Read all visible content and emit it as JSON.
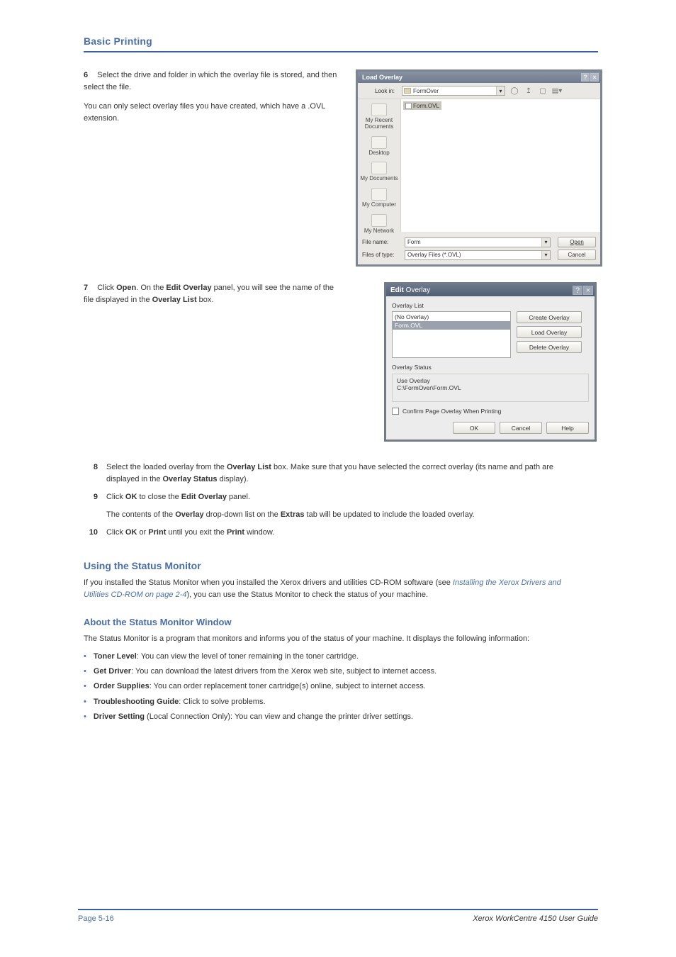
{
  "page_title": "Basic Printing",
  "steps": {
    "s6": {
      "num": "6",
      "text_a": "Select the drive and folder in which the overlay file is stored, and then select the file.",
      "text_b": "You can only select overlay files you have created, which have a .OVL extension."
    },
    "s7": {
      "num": "7",
      "text_a": "Click ",
      "btn": "Open",
      "text_b": ". On the ",
      "panel": "Edit Overlay",
      "text_c": " panel, you will see the name of the file displayed in the ",
      "list": "Overlay List",
      "text_d": " box."
    },
    "s8": {
      "num": "8",
      "text_a": "Select the loaded overlay from the ",
      "list": "Overlay List",
      "text_b": " box. Make sure that you have selected the correct overlay (its name and path are displayed in the ",
      "status": "Overlay Status",
      "text_c": " display)."
    },
    "s9": {
      "num": "9",
      "text_a": "Click ",
      "btn": "OK",
      "text_b": " to close the ",
      "panel": "Edit Overlay",
      "text_c": " panel.",
      "para_a": "The contents of the ",
      "label1": "Overlay",
      "para_b": " drop-down list on the ",
      "tab": "Extras",
      "para_c": " tab will be updated to include the loaded overlay."
    },
    "s10": {
      "num": "10",
      "text_a": "Click ",
      "btn1": "OK",
      "text_b": " or ",
      "btn2": "Print",
      "text_c": " until you exit the ",
      "dlg": "Print",
      "text_d": " window."
    }
  },
  "load_dialog": {
    "title": "Load Overlay",
    "lookin_label": "Look in:",
    "lookin_value": "FormOver",
    "places": [
      "My Recent Documents",
      "Desktop",
      "My Documents",
      "My Computer",
      "My Network"
    ],
    "file_item": "Form.OVL",
    "filename_label": "File name:",
    "filename_value": "Form",
    "filetype_label": "Files of type:",
    "filetype_value": "Overlay Files (*.OVL)",
    "open_btn": "Open",
    "cancel_btn": "Cancel"
  },
  "edit_dialog": {
    "title_bold": "Edit",
    "title_rest": " Overlay",
    "list_label": "Overlay List",
    "item_no": "(No Overlay)",
    "item_sel": "Form.OVL",
    "btn_create": "Create Overlay",
    "btn_load": "Load Overlay",
    "btn_delete": "Delete Overlay",
    "status_label": "Overlay Status",
    "status_line1": "Use Overlay",
    "status_line2": "C:\\FormOver\\Form.OVL",
    "checkbox": "Confirm Page Overlay When Printing",
    "ok": "OK",
    "cancel": "Cancel",
    "help": "Help"
  },
  "section": {
    "heading": "Using the Status Monitor",
    "intro_a": "If you installed the Status Monitor when you installed the Xerox drivers and utilities CD-ROM software (see ",
    "intro_link": "Installing the Xerox Drivers and Utilities CD-ROM on page 2-4",
    "intro_b": "), you can use the Status Monitor to check the status of your machine.",
    "sub_heading": "About the Status Monitor Window",
    "sub_intro": "The Status Monitor is a program that monitors and informs you of the status of your machine. It displays the following information:",
    "bullets": [
      {
        "label": "Toner Level",
        "text": ": You can view the level of toner remaining in the toner cartridge."
      },
      {
        "label": "Get Driver",
        "text": ": You can download the latest drivers from the Xerox web site, subject to internet access."
      },
      {
        "label": "Order Supplies",
        "text": ": You can order replacement toner cartridge(s) online, subject to internet access."
      },
      {
        "label": "Troubleshooting Guide",
        "text": ": Click to solve problems."
      },
      {
        "label": "Driver Setting",
        "text": " (Local Connection Only): You can view and change the printer driver settings."
      }
    ]
  },
  "footer": {
    "left": "Page 5-16",
    "right_em": "Xerox WorkCentre 4150 User Guide"
  }
}
